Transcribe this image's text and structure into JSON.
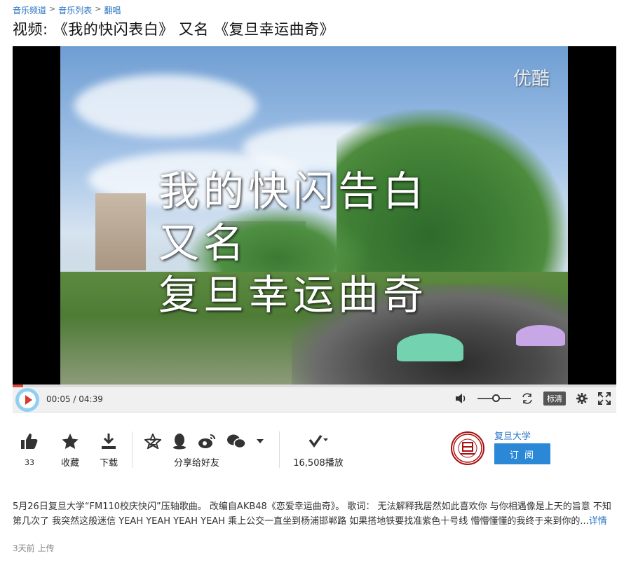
{
  "breadcrumb": {
    "items": [
      "音乐频道",
      "音乐列表",
      "翻唱"
    ],
    "separator": ">"
  },
  "title": "视频: 《我的快闪表白》 又名 《复旦幸运曲奇》",
  "player": {
    "caption_line1": "我的快闪告白",
    "caption_line2": "又名",
    "caption_line3": "复旦幸运曲奇",
    "watermark": "优酷",
    "progress_fraction": 0.018,
    "time_current": "00:05",
    "time_total": "04:39",
    "time_separator": " / ",
    "quality": "标清",
    "volume_fraction": 0.55
  },
  "actions": {
    "like_count": "33",
    "favorite_label": "收藏",
    "download_label": "下载",
    "share_label": "分享给好友",
    "play_count": "16,508播放"
  },
  "channel": {
    "name": "复旦大学",
    "subscribe_label": "订 阅",
    "logo_text": "旦"
  },
  "description": {
    "text": "5月26日复旦大学“FM110校庆快闪”压轴歌曲。 改编自AKB48《恋爱幸运曲奇》。 歌词： 无法解释我居然如此喜欢你 与你相遇像是上天的旨意 不知第几次了 我突然这般迷信 YEAH YEAH YEAH YEAH 乘上公交一直坐到杨浦邯郸路 如果搭地铁要找准紫色十号线 懵懵懂懂的我终于来到你的...",
    "more_label": "详情"
  },
  "uploaded": "3天前 上传",
  "colors": {
    "link": "#2a74c4",
    "progress": "#d94a3a",
    "subscribe": "#2a88d6"
  }
}
